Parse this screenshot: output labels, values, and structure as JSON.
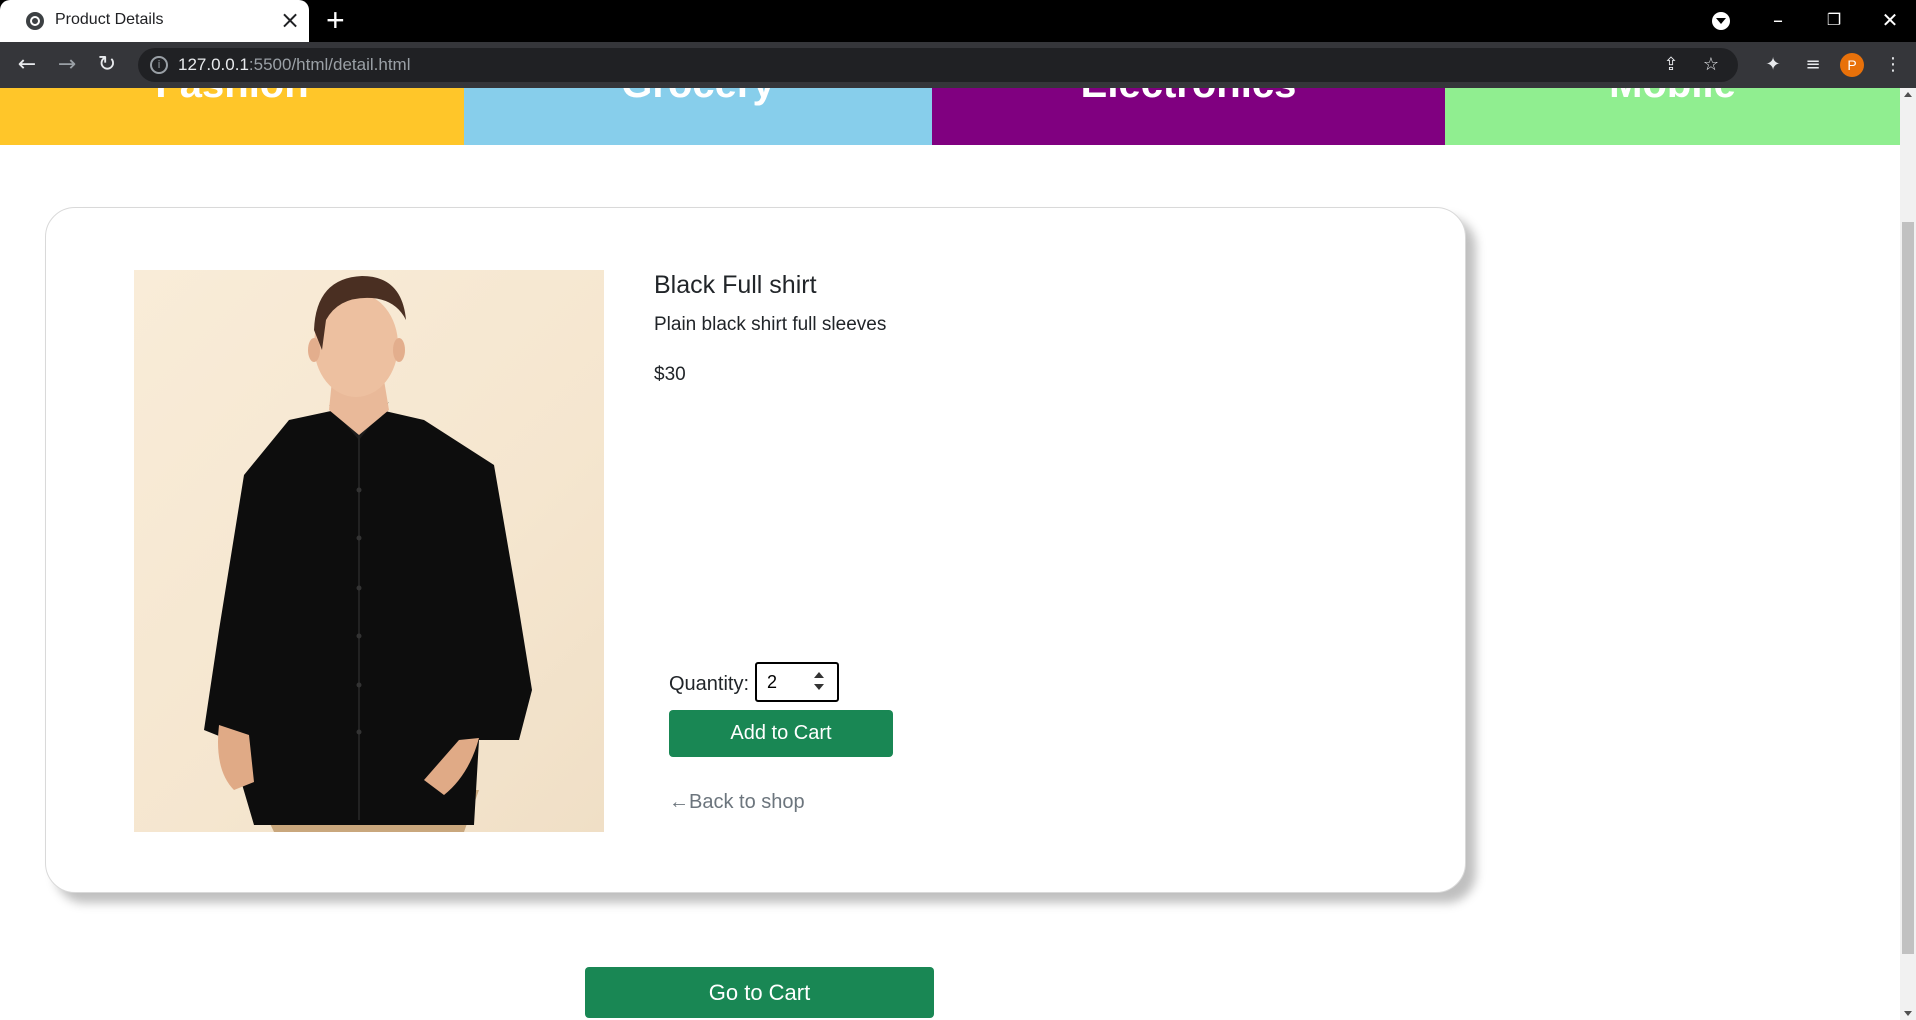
{
  "browser": {
    "tab_title": "Product Details",
    "url_host": "127.0.0.1",
    "url_path": ":5500/html/detail.html",
    "profile_initial": "P"
  },
  "categories": [
    {
      "label": "Fashion",
      "color": "#ffc629"
    },
    {
      "label": "Grocery",
      "color": "#87ceeb"
    },
    {
      "label": "Electronics",
      "color": "#800080"
    },
    {
      "label": "Mobile",
      "color": "#90ee90"
    }
  ],
  "product": {
    "title": "Black Full shirt",
    "description": "Plain black shirt full sleeves",
    "price": "$30",
    "image_icon": "product-photo-black-shirt"
  },
  "cart_form": {
    "quantity_label": "Quantity:",
    "quantity_value": "2",
    "add_button": "Add to Cart",
    "back_link": "←Back to shop"
  },
  "go_to_cart": "Go to Cart",
  "colors": {
    "button_green": "#198754"
  }
}
